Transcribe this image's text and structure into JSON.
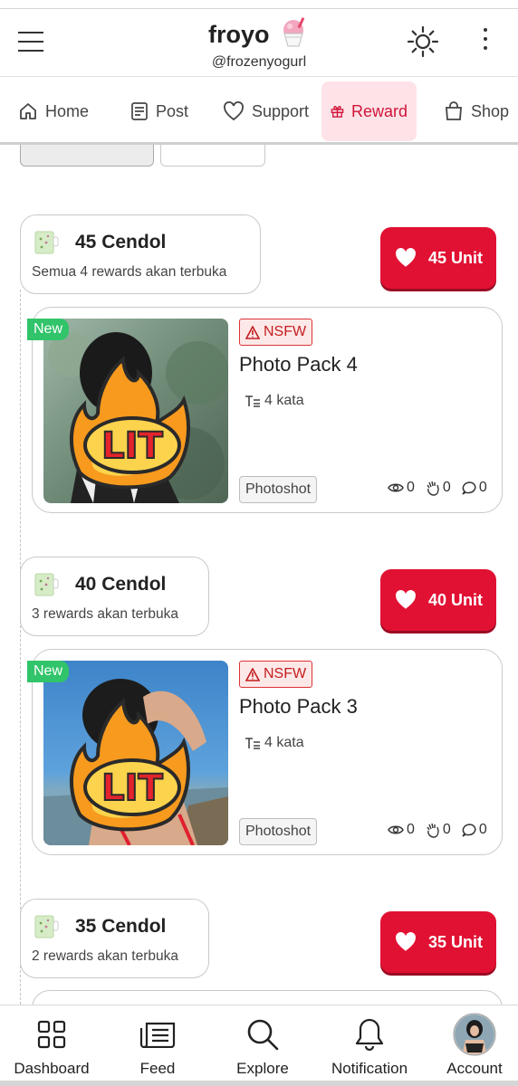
{
  "header": {
    "title": "froyo",
    "handle": "@frozenyogurl"
  },
  "tabs": [
    {
      "label": "Home",
      "icon": "home-icon"
    },
    {
      "label": "Post",
      "icon": "post-icon"
    },
    {
      "label": "Support",
      "icon": "heart-icon"
    },
    {
      "label": "Reward",
      "icon": "gift-icon",
      "active": true
    },
    {
      "label": "Shop",
      "icon": "shopping-bag-icon"
    }
  ],
  "tiers": [
    {
      "name": "45 Cendol",
      "desc": "Semua 4 rewards akan terbuka",
      "button": "45 Unit",
      "card": {
        "badge": "New",
        "nsfw": "NSFW",
        "title": "Photo Pack 4",
        "words": "4 kata",
        "category": "Photoshot",
        "views": "0",
        "claps": "0",
        "comments": "0"
      }
    },
    {
      "name": "40 Cendol",
      "desc": "3 rewards akan terbuka",
      "button": "40 Unit",
      "card": {
        "badge": "New",
        "nsfw": "NSFW",
        "title": "Photo Pack 3",
        "words": "4 kata",
        "category": "Photoshot",
        "views": "0",
        "claps": "0",
        "comments": "0"
      }
    },
    {
      "name": "35 Cendol",
      "desc": "2 rewards akan terbuka",
      "button": "35 Unit"
    }
  ],
  "sticker_text": "LIT",
  "bottom_nav": [
    {
      "label": "Dashboard",
      "icon": "dashboard-icon"
    },
    {
      "label": "Feed",
      "icon": "feed-icon"
    },
    {
      "label": "Explore",
      "icon": "search-icon"
    },
    {
      "label": "Notification",
      "icon": "bell-icon"
    },
    {
      "label": "Account",
      "icon": "avatar"
    }
  ],
  "colors": {
    "accent": "#e11133",
    "tab_active_bg": "#fde3e7",
    "new_badge": "#31c46a",
    "nsfw": "#c41e1e"
  }
}
